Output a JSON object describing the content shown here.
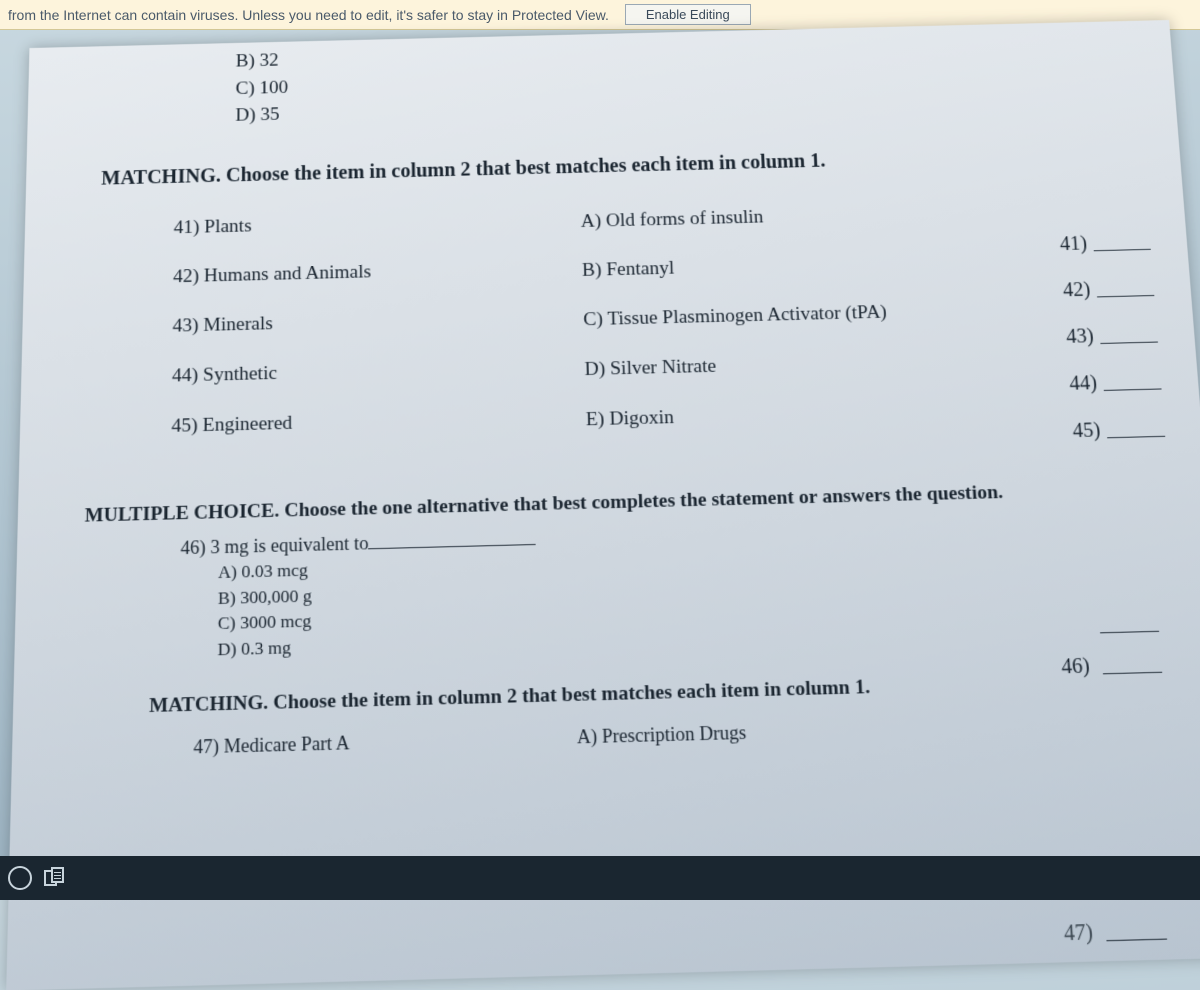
{
  "protected_view": {
    "message": "from the Internet can contain viruses. Unless you need to edit, it's safer to stay in Protected View.",
    "button": "Enable Editing"
  },
  "prev_question_options": {
    "b": "B) 32",
    "c": "C) 100",
    "d": "D) 35"
  },
  "matching_header": "MATCHING. Choose the item in column 2 that best matches each item in column 1.",
  "column1": [
    "41) Plants",
    "42) Humans and Animals",
    "43) Minerals",
    "44) Synthetic",
    "45) Engineered"
  ],
  "column2": [
    "A) Old forms of insulin",
    "B) Fentanyl",
    "C) Tissue Plasminogen Activator (tPA)",
    "D) Silver Nitrate",
    "E) Digoxin"
  ],
  "answer_nums": [
    "41)",
    "42)",
    "43)",
    "44)",
    "45)"
  ],
  "mc_header": "MULTIPLE CHOICE. Choose the one alternative that best completes the statement or answers the question.",
  "q46": {
    "stem": "46) 3 mg is equivalent to",
    "a": "A) 0.03 mcg",
    "b": "B) 300,000 g",
    "c": "C) 3000 mcg",
    "d": "D) 0.3 mg",
    "ans_num": "46)"
  },
  "matching2_header": "MATCHING. Choose the item in column 2 that best matches each item in column 1.",
  "q47": {
    "c1": "47) Medicare Part A",
    "c2": "A) Prescription Drugs",
    "ans_num": "47)"
  }
}
